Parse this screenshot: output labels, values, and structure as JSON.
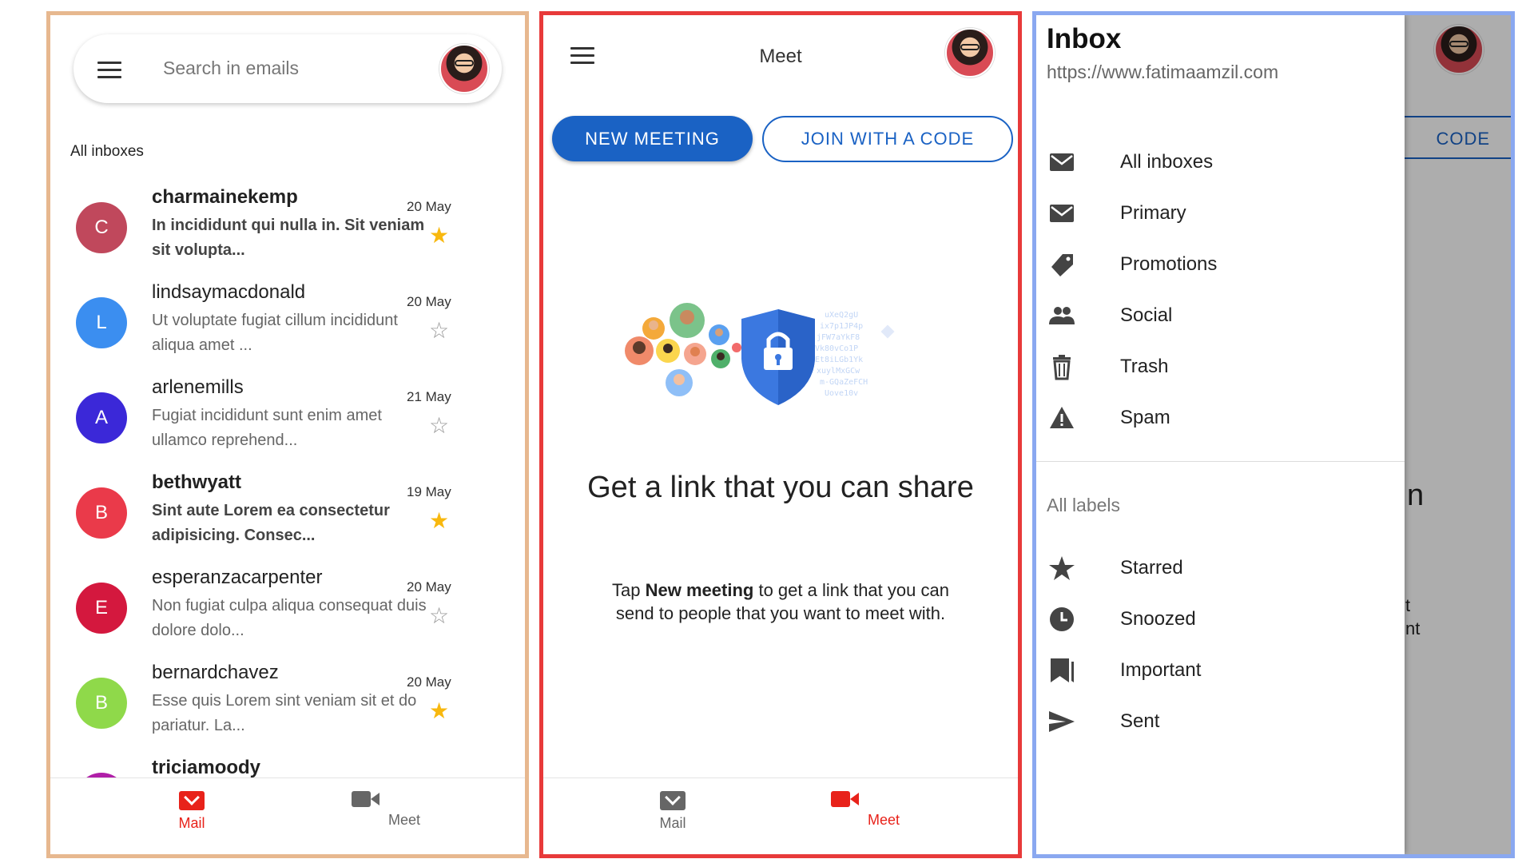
{
  "mail_screen": {
    "search_placeholder": "Search in emails",
    "section_label": "All inboxes",
    "emails": [
      {
        "initial": "C",
        "color": "#c0485c",
        "sender": "charmainekemp",
        "preview": "In incididunt qui nulla in. Sit veniam sit volupta...",
        "date": "20 May",
        "starred": true,
        "unread": true
      },
      {
        "initial": "L",
        "color": "#3b8ef0",
        "sender": "lindsaymacdonald",
        "preview": "Ut voluptate fugiat cillum incididunt aliqua amet ...",
        "date": "20 May",
        "starred": false,
        "unread": false
      },
      {
        "initial": "A",
        "color": "#3b28d8",
        "sender": "arlenemills",
        "preview": "Fugiat incididunt sunt enim amet ullamco reprehend...",
        "date": "21 May",
        "starred": false,
        "unread": false
      },
      {
        "initial": "B",
        "color": "#ea3a4a",
        "sender": "bethwyatt",
        "preview": "Sint aute Lorem ea consectetur adipisicing. Consec...",
        "date": "19 May",
        "starred": true,
        "unread": true
      },
      {
        "initial": "E",
        "color": "#d4183e",
        "sender": "esperanzacarpenter",
        "preview": "Non fugiat culpa aliqua consequat duis dolore dolo...",
        "date": "20 May",
        "starred": false,
        "unread": false
      },
      {
        "initial": "B",
        "color": "#8fd94a",
        "sender": "bernardchavez",
        "preview": "Esse quis Lorem sint veniam sit et do pariatur. La...",
        "date": "20 May",
        "starred": true,
        "unread": false
      },
      {
        "initial": "",
        "color": "#b01fa8",
        "sender": "triciamoody",
        "preview": "",
        "date": "",
        "starred": false,
        "unread": true
      }
    ],
    "nav": {
      "mail": "Mail",
      "meet": "Meet"
    }
  },
  "meet_screen": {
    "title": "Meet",
    "new_meeting": "NEW MEETING",
    "join_code": "JOIN WITH A CODE",
    "headline": "Get a link that you can share",
    "sub_pre": "Tap ",
    "sub_bold": "New meeting",
    "sub_post": " to get a link that you can send to people that you want to meet with.",
    "nav": {
      "mail": "Mail",
      "meet": "Meet"
    }
  },
  "drawer_screen": {
    "title": "Inbox",
    "url": "https://www.fatimaamzil.com",
    "items": [
      "All inboxes",
      "Primary",
      "Promotions",
      "Social",
      "Trash",
      "Spam"
    ],
    "labels_heading": "All labels",
    "label_items": [
      "Starred",
      "Snoozed",
      "Important",
      "Sent"
    ],
    "under_button": "CODE",
    "under_headline": "n",
    "under_sub1": "t",
    "under_sub2": "nt"
  },
  "colors": {
    "accent_red": "#e8221a",
    "accent_blue": "#1a62c4",
    "star_yellow": "#f8b80e",
    "frame_mail": "#e7b88f",
    "frame_meet": "#e83a3a",
    "frame_drawer": "#8aa8f0"
  }
}
